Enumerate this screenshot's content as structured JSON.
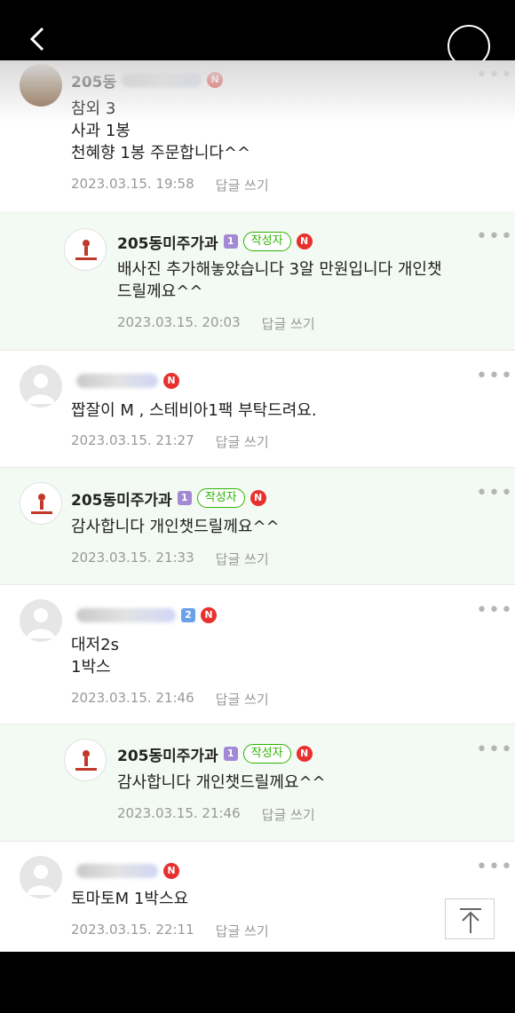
{
  "comments": [
    {
      "author": "205동",
      "level": "",
      "badge_new": "N",
      "lines": [
        "참외 3",
        "사과 1봉",
        "천혜향 1봉 주문합니다^^"
      ],
      "time": "2023.03.15. 19:58",
      "reply_label": "답글 쓰기"
    },
    {
      "author": "205동미주가과",
      "level": "1",
      "writer_badge": "작성자",
      "badge_new": "N",
      "lines": [
        "배사진 추가해놓았습니다 3알 만원입니다 개인챗",
        "드릴께요^^"
      ],
      "time": "2023.03.15. 20:03",
      "reply_label": "답글 쓰기"
    },
    {
      "author": "",
      "level": "",
      "badge_new": "N",
      "lines": [
        "짭잘이 M , 스테비아1팩 부탁드려요."
      ],
      "time": "2023.03.15. 21:27",
      "reply_label": "답글 쓰기"
    },
    {
      "author": "205동미주가과",
      "level": "1",
      "writer_badge": "작성자",
      "badge_new": "N",
      "lines": [
        "감사합니다 개인챗드릴께요^^"
      ],
      "time": "2023.03.15. 21:33",
      "reply_label": "답글 쓰기"
    },
    {
      "author": "",
      "level": "2",
      "badge_new": "N",
      "lines": [
        "대저2s",
        "1박스"
      ],
      "time": "2023.03.15. 21:46",
      "reply_label": "답글 쓰기"
    },
    {
      "author": "205동미주가과",
      "level": "1",
      "writer_badge": "작성자",
      "badge_new": "N",
      "lines": [
        "감사합니다 개인챗드릴께요^^"
      ],
      "time": "2023.03.15. 21:46",
      "reply_label": "답글 쓰기"
    },
    {
      "author": "",
      "level": "",
      "badge_new": "N",
      "lines": [
        "토마토M 1박스요"
      ],
      "time": "2023.03.15. 22:11",
      "reply_label": "답글 쓰기"
    }
  ],
  "colors": {
    "writer_green": "#2db400",
    "new_red": "#e8302f",
    "reply_bg": "#f3f9f3"
  },
  "icons": {
    "back": "chevron-left-icon",
    "top": "circle-icon",
    "more": "more-icon",
    "scroll_top": "arrow-up-icon"
  }
}
